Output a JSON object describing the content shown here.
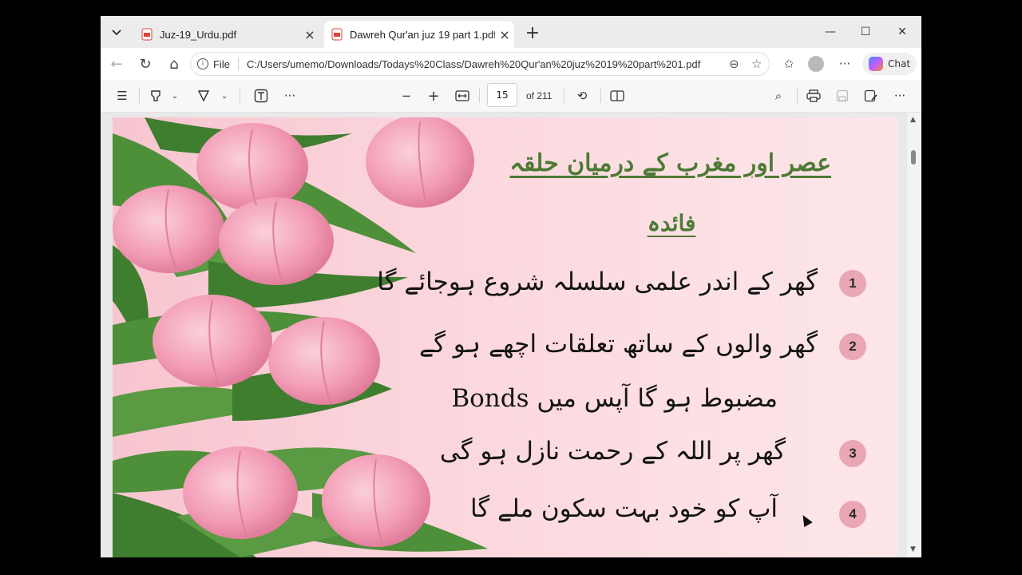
{
  "tabs": [
    {
      "title": "Juz-19_Urdu.pdf",
      "active": false
    },
    {
      "title": "Dawreh Qur'an juz 19 part 1.pdf",
      "active": true
    }
  ],
  "address": {
    "scheme_label": "File",
    "url": "C:/Users/umemo/Downloads/Todays%20Class/Dawreh%20Qur'an%20juz%2019%20part%201.pdf"
  },
  "toolbar": {
    "chat_label": "Chat",
    "page_current": "15",
    "page_total": "of 211"
  },
  "icons": {
    "tab_dropdown": "chevron-down",
    "close": "×",
    "new_tab": "+",
    "minimize": "—",
    "maximize": "☐",
    "window_close": "✕",
    "back": "←",
    "refresh": "↻",
    "home": "⌂",
    "zoom_out": "−",
    "zoom_in": "+",
    "more": "···",
    "search": "⌕",
    "print": "⎙"
  },
  "slide": {
    "heading": "عصر اور مغرب کے درمیان حلقہ",
    "subheading": "فائدہ",
    "items": [
      {
        "number": "1",
        "text": "گھر کے اندر علمی سلسلہ شروع ہوجائے گا"
      },
      {
        "number": "2",
        "text": "گھر والوں کے ساتھ تعلقات اچھے ہو گے",
        "continuation": "مضبوط ہو گا آپس میں Bonds"
      },
      {
        "number": "3",
        "text": "گھر پر اللہ کے رحمت نازل ہو گی"
      },
      {
        "number": "4",
        "text": "آپ کو خود بہت سکون ملے گا"
      }
    ]
  },
  "colors": {
    "heading_green": "#4d7a35",
    "badge_pink": "#e9a6b3",
    "tulip_pink": "#f29bb4",
    "leaf_green": "#4e8f3a"
  }
}
